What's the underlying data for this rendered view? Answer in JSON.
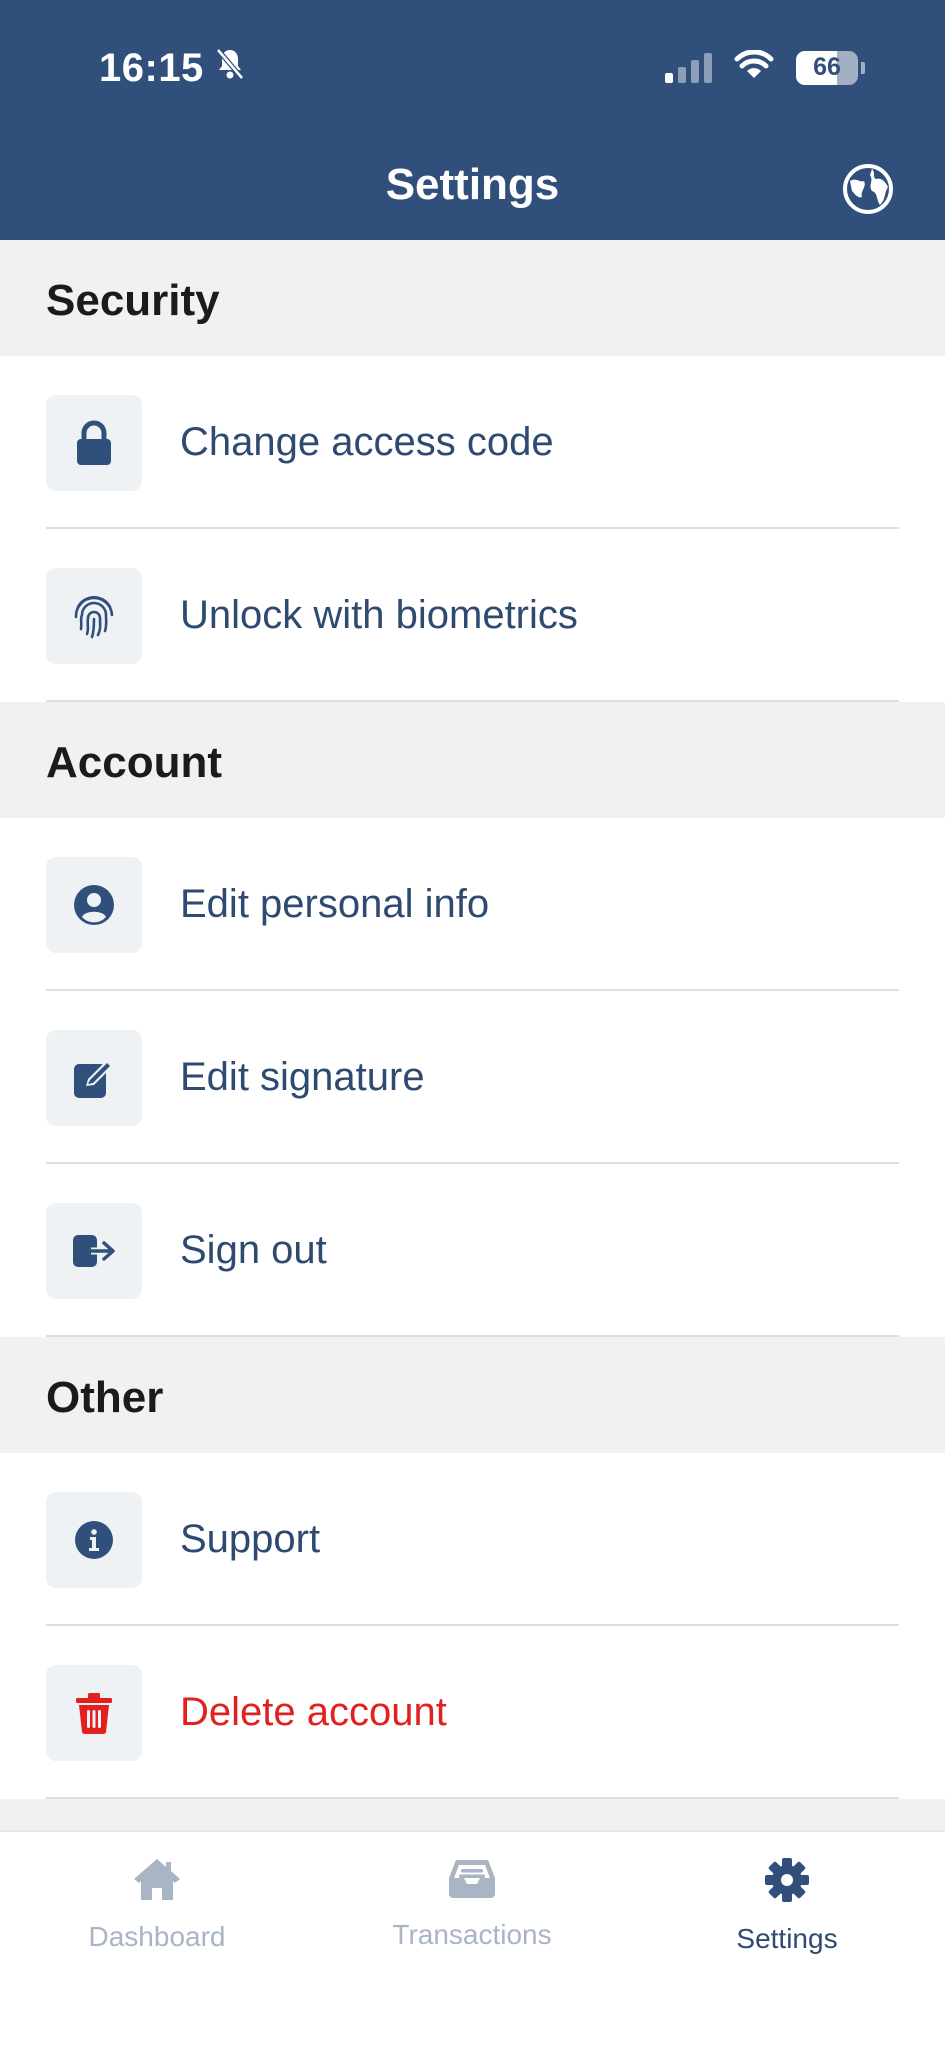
{
  "status_bar": {
    "time": "16:15",
    "battery": "66",
    "battery_level": 0.66
  },
  "header": {
    "title": "Settings"
  },
  "sections": [
    {
      "title": "Security",
      "items": [
        {
          "label": "Change access code",
          "icon": "lock-icon"
        },
        {
          "label": "Unlock with biometrics",
          "icon": "fingerprint-icon"
        }
      ]
    },
    {
      "title": "Account",
      "items": [
        {
          "label": "Edit personal info",
          "icon": "user-circle-icon"
        },
        {
          "label": "Edit signature",
          "icon": "edit-icon"
        },
        {
          "label": "Sign out",
          "icon": "sign-out-icon"
        }
      ]
    },
    {
      "title": "Other",
      "items": [
        {
          "label": "Support",
          "icon": "info-icon"
        },
        {
          "label": "Delete account",
          "icon": "trash-icon",
          "danger": true
        }
      ]
    }
  ],
  "tabs": [
    {
      "label": "Dashboard",
      "icon": "home-icon",
      "active": false
    },
    {
      "label": "Transactions",
      "icon": "inbox-icon",
      "active": false
    },
    {
      "label": "Settings",
      "icon": "gear-icon",
      "active": true
    }
  ],
  "colors": {
    "header": "#30507b",
    "accent": "#2e4a70",
    "danger": "#e12020",
    "tab_inactive": "#a9b4c4"
  }
}
